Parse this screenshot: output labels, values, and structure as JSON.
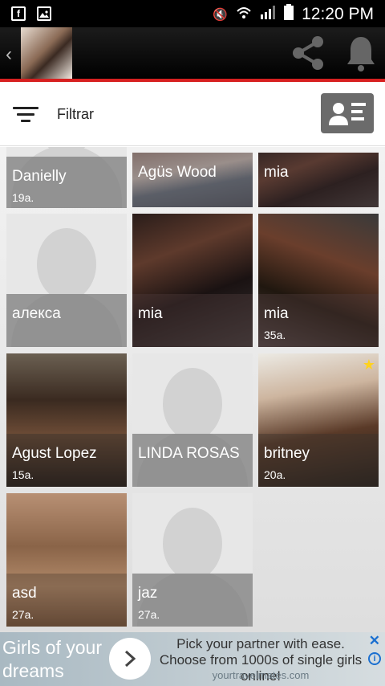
{
  "statusbar": {
    "time": "12:20 PM",
    "left_icons": [
      "facebook-icon",
      "image-icon"
    ]
  },
  "appbar": {
    "back_glyph": "‹"
  },
  "filter": {
    "label": "Filtrar"
  },
  "profiles": [
    {
      "name": "Danielly",
      "age": "19a."
    },
    {
      "name": "Agüs Wood",
      "age": ""
    },
    {
      "name": "mia",
      "age": ""
    },
    {
      "name": "алекса",
      "age": ""
    },
    {
      "name": "mia",
      "age": ""
    },
    {
      "name": "mia",
      "age": "35a."
    },
    {
      "name": "Agust Lopez",
      "age": "15a."
    },
    {
      "name": "LINDA ROSAS",
      "age": ""
    },
    {
      "name": "britney",
      "age": "20a."
    },
    {
      "name": "asd",
      "age": "27a."
    },
    {
      "name": "jaz",
      "age": "27a."
    }
  ],
  "ad": {
    "headline": "Girls of your dreams",
    "body": "Pick your partner with ease. Choose from 1000s of single girls online!",
    "url": "yourtravelmates.com"
  },
  "colors": {
    "accent_red": "#d72020",
    "star": "#ffd21e",
    "ad_blue": "#1a6fd0"
  }
}
